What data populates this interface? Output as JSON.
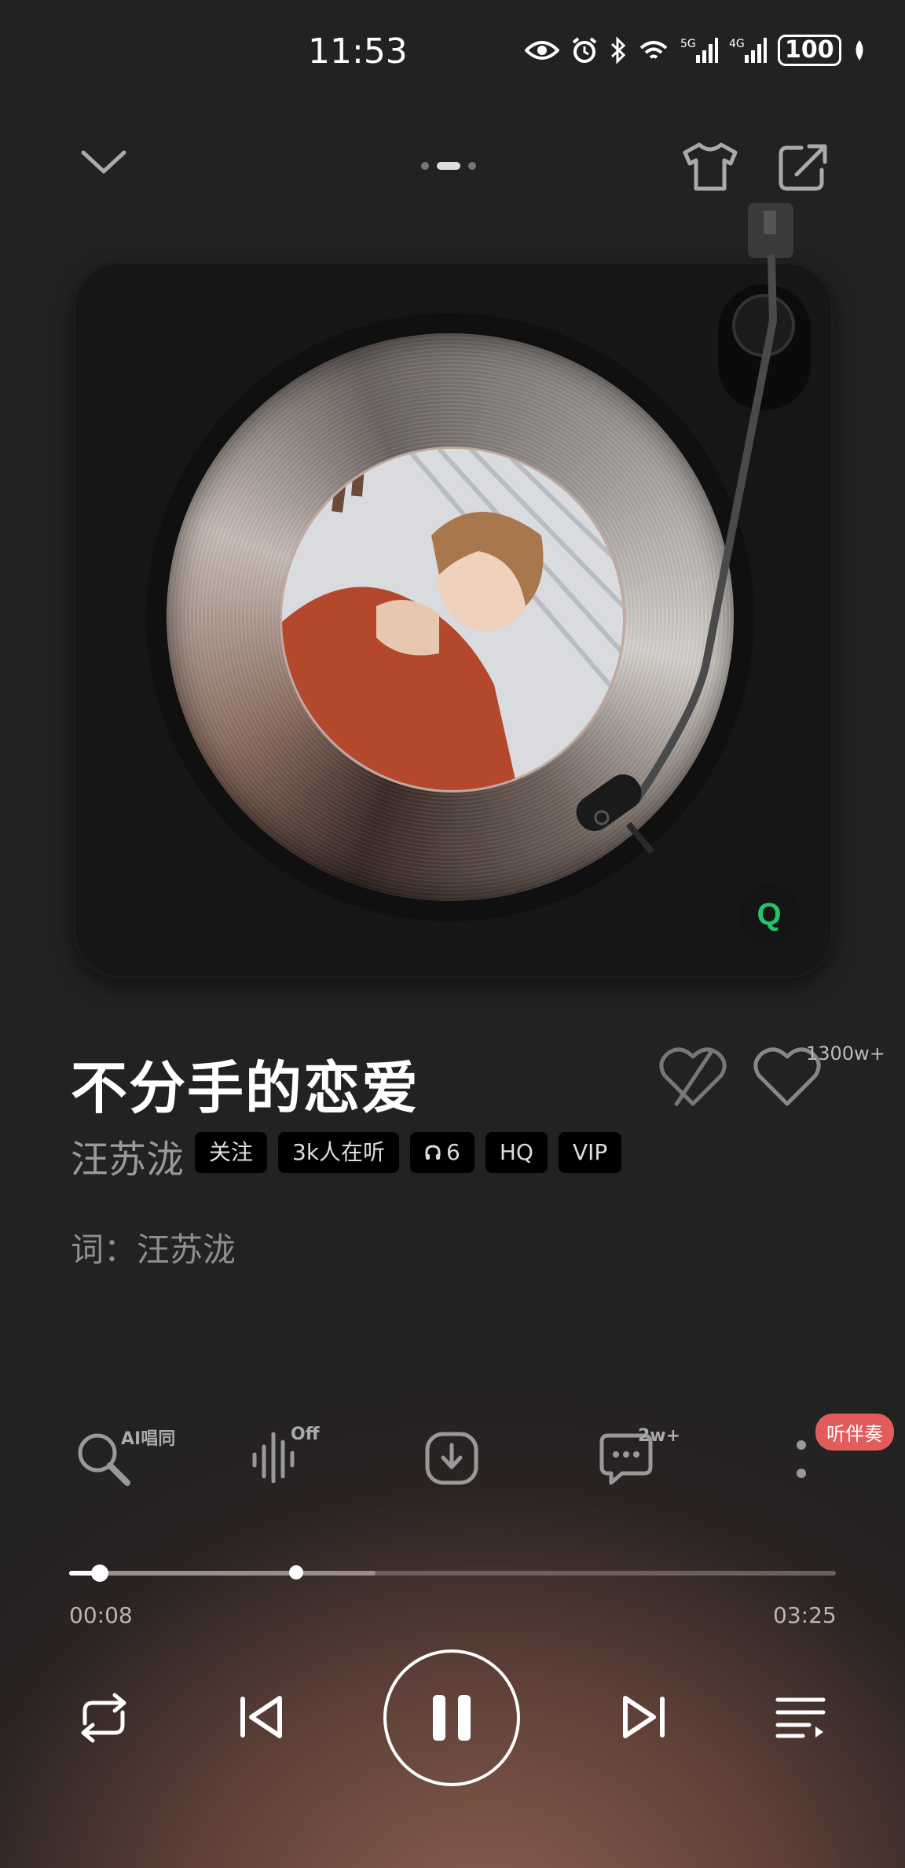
{
  "status_bar": {
    "time": "11:53",
    "battery": "100"
  },
  "header": {
    "pages": 3,
    "active_page": 2
  },
  "song": {
    "title": "不分手的恋爱",
    "artist": "汪苏泷",
    "tags": {
      "follow": "关注",
      "listeners": "3k人在听",
      "headphones": "6",
      "quality": "HQ",
      "vip": "VIP"
    },
    "like_count": "1300w+",
    "lyricist": "词：汪苏泷"
  },
  "actions": {
    "ai_sing": "AI唱同",
    "effect": "Off",
    "comments": "2w+",
    "accompaniment": "听伴奏"
  },
  "progress": {
    "current": "00:08",
    "total": "03:25",
    "fraction": 0.04,
    "buffered_fraction": 0.4
  },
  "colors": {
    "accent_green": "#22c46a",
    "badge_red": "#e25c5c"
  }
}
